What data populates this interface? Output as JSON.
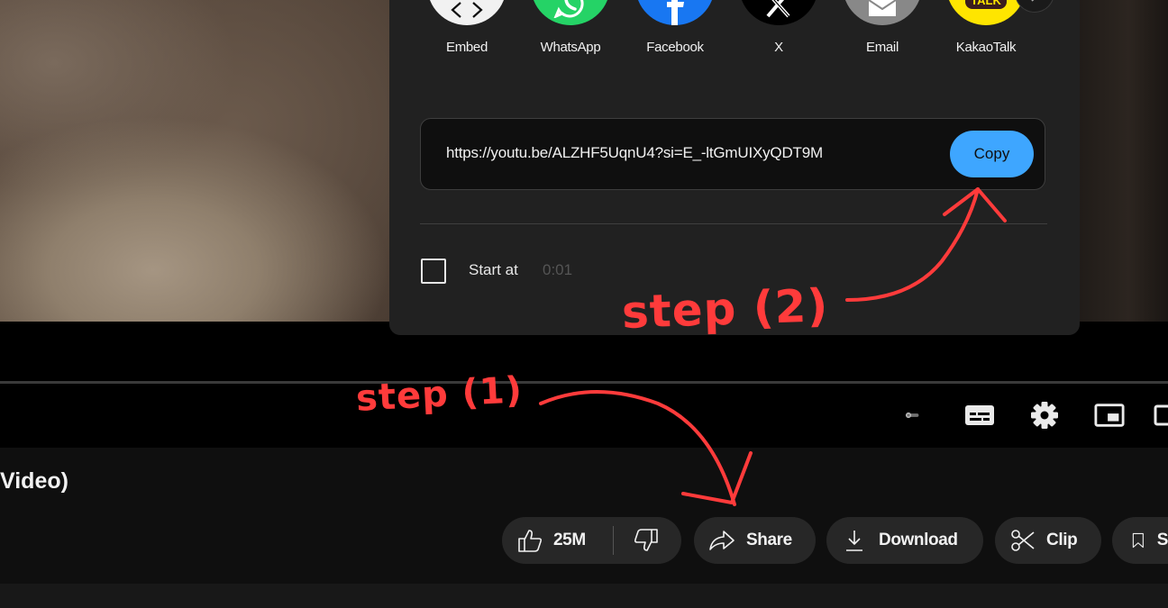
{
  "share_dialog": {
    "targets": [
      {
        "label": "Embed",
        "icon": "embed-icon",
        "color": "#f1f1f1"
      },
      {
        "label": "WhatsApp",
        "icon": "whatsapp-icon",
        "color": "#25d366"
      },
      {
        "label": "Facebook",
        "icon": "facebook-icon",
        "color": "#1877f2"
      },
      {
        "label": "X",
        "icon": "x-icon",
        "color": "#000000"
      },
      {
        "label": "Email",
        "icon": "email-icon",
        "color": "#888888"
      },
      {
        "label": "KakaoTalk",
        "icon": "kakaotalk-icon",
        "color": "#fee500"
      }
    ],
    "kakao_badge": "TALK",
    "next_icon": "chevron-right-icon",
    "link": "https://youtu.be/ALZHF5UqnU4?si=E_-ltGmUIXyQDT9M",
    "copy_label": "Copy",
    "start_at_label": "Start at",
    "start_at_time": "0:01",
    "start_at_checked": false
  },
  "video": {
    "title_fragment": "Video)"
  },
  "actions": {
    "like_count": "25M",
    "share_label": "Share",
    "download_label": "Download",
    "clip_label": "Clip",
    "save_fragment": "S"
  },
  "annotations": {
    "step1": "step (1)",
    "step2": "step (2)",
    "color": "#ff3b3b"
  },
  "colors": {
    "accent": "#3ea6ff",
    "dialog_bg": "#212121",
    "pill_bg": "#272727"
  }
}
